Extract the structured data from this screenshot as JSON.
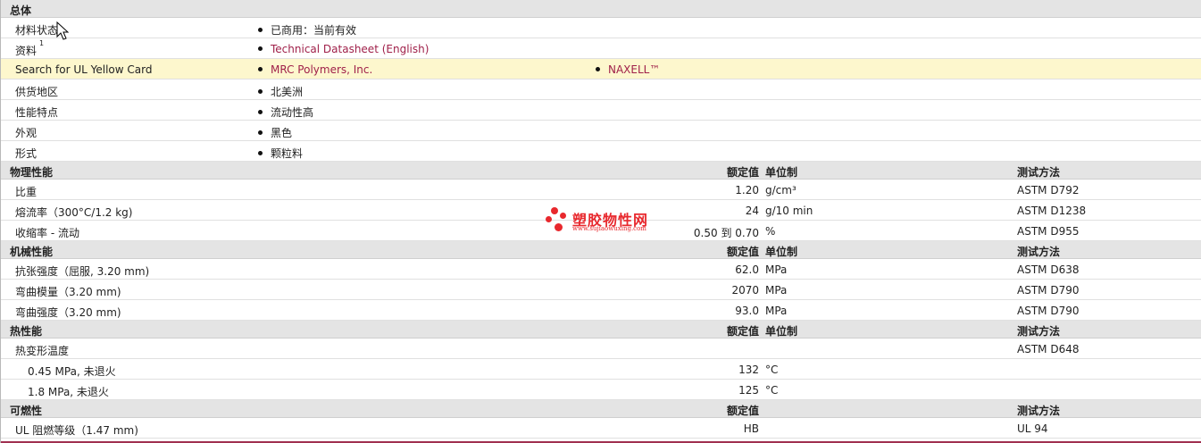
{
  "sections": {
    "general": {
      "title": "总体"
    },
    "physical": {
      "title": "物理性能",
      "col_value": "额定值",
      "col_unit": "单位制",
      "col_test": "测试方法"
    },
    "mechanical": {
      "title": "机械性能",
      "col_value": "额定值",
      "col_unit": "单位制",
      "col_test": "测试方法"
    },
    "thermal": {
      "title": "热性能",
      "col_value": "额定值",
      "col_unit": "单位制",
      "col_test": "测试方法"
    },
    "flammability": {
      "title": "可燃性",
      "col_value": "额定值",
      "col_test": "测试方法"
    }
  },
  "general_rows": {
    "status": {
      "label": "材料状态",
      "value": "已商用：当前有效"
    },
    "docs": {
      "label": "资料",
      "sup": "1",
      "link": "Technical Datasheet (English)"
    },
    "ul": {
      "label": "Search for UL Yellow Card",
      "link1": "MRC Polymers, Inc.",
      "link2": "NAXELL™"
    },
    "region": {
      "label": "供货地区",
      "value": "北美洲"
    },
    "features": {
      "label": "性能特点",
      "value": "流动性高"
    },
    "appearance": {
      "label": "外观",
      "value": "黑色"
    },
    "form": {
      "label": "形式",
      "value": "颗粒料"
    }
  },
  "physical_rows": [
    {
      "label": "比重",
      "value": "1.20",
      "unit": "g/cm³",
      "test": "ASTM D792"
    },
    {
      "label": "熔流率（300°C/1.2 kg)",
      "value": "24",
      "unit": "g/10 min",
      "test": "ASTM D1238"
    },
    {
      "label": "收缩率 - 流动",
      "value": "0.50 到  0.70",
      "unit": "%",
      "test": "ASTM D955"
    }
  ],
  "mechanical_rows": [
    {
      "label": "抗张强度（屈服, 3.20 mm)",
      "value": "62.0",
      "unit": "MPa",
      "test": "ASTM D638"
    },
    {
      "label": "弯曲模量（3.20 mm)",
      "value": "2070",
      "unit": "MPa",
      "test": "ASTM D790"
    },
    {
      "label": "弯曲强度（3.20 mm)",
      "value": "93.0",
      "unit": "MPa",
      "test": "ASTM D790"
    }
  ],
  "thermal_rows": {
    "hdt": {
      "label": "热变形温度",
      "test": "ASTM D648"
    },
    "r1": {
      "label": "0.45 MPa, 未退火",
      "value": "132",
      "unit": "°C"
    },
    "r2": {
      "label": "1.8 MPa, 未退火",
      "value": "125",
      "unit": "°C"
    }
  },
  "flammability_rows": [
    {
      "label": "UL 阻燃等级（1.47 mm)",
      "value": "HB",
      "test": "UL 94"
    }
  ],
  "watermark": {
    "name": "塑胶物性网",
    "url": "www.sujiaowuxing.com",
    "color": "#e8282d"
  },
  "colors": {
    "link": "#a0214a",
    "highlight": "#fdf7cd",
    "section_bg": "#e4e4e4"
  }
}
